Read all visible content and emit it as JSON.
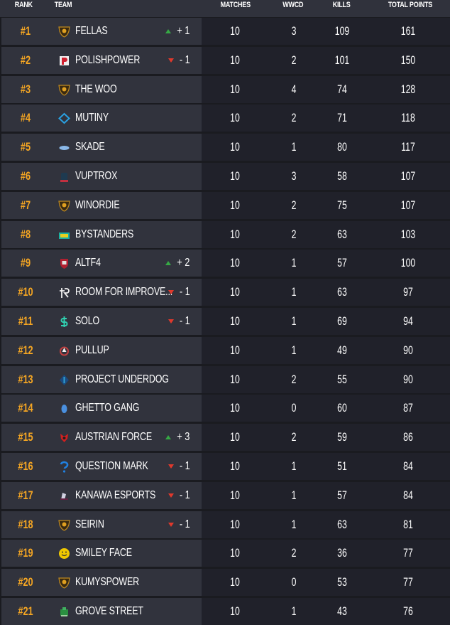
{
  "colors": {
    "rank": "#f5a623",
    "up": "#36a845",
    "down": "#e0392c"
  },
  "header": {
    "rank": "RANK",
    "team": "TEAM",
    "matches": "MATCHES",
    "wwcd": "WWCD",
    "kills": "KILLS",
    "total_points": "TOTAL POINTS"
  },
  "rows": [
    {
      "rank": "#1",
      "team": "FELLAS",
      "logo": "shield-lion-logo",
      "change_dir": "up",
      "change": "+ 1",
      "matches": "10",
      "wwcd": "3",
      "kills": "109",
      "total": "161"
    },
    {
      "rank": "#2",
      "team": "POLISHPOWER",
      "logo": "p-logo",
      "change_dir": "down",
      "change": "- 1",
      "matches": "10",
      "wwcd": "2",
      "kills": "101",
      "total": "150"
    },
    {
      "rank": "#3",
      "team": "THE WOO",
      "logo": "shield-lion-logo",
      "change_dir": "",
      "change": "",
      "matches": "10",
      "wwcd": "4",
      "kills": "74",
      "total": "128"
    },
    {
      "rank": "#4",
      "team": "MUTINY",
      "logo": "diamond-logo",
      "change_dir": "",
      "change": "",
      "matches": "10",
      "wwcd": "2",
      "kills": "71",
      "total": "118"
    },
    {
      "rank": "#5",
      "team": "SKADE",
      "logo": "fish-logo",
      "change_dir": "",
      "change": "",
      "matches": "10",
      "wwcd": "1",
      "kills": "80",
      "total": "117"
    },
    {
      "rank": "#6",
      "team": "VUPTROX",
      "logo": "creature-logo",
      "change_dir": "",
      "change": "",
      "matches": "10",
      "wwcd": "3",
      "kills": "58",
      "total": "107"
    },
    {
      "rank": "#7",
      "team": "WINORDIE",
      "logo": "shield-lion-logo",
      "change_dir": "",
      "change": "",
      "matches": "10",
      "wwcd": "2",
      "kills": "75",
      "total": "107"
    },
    {
      "rank": "#8",
      "team": "BYSTANDERS",
      "logo": "tv-logo",
      "change_dir": "",
      "change": "",
      "matches": "10",
      "wwcd": "2",
      "kills": "63",
      "total": "103"
    },
    {
      "rank": "#9",
      "team": "ALTF4",
      "logo": "shield-f4-logo",
      "change_dir": "up",
      "change": "+ 2",
      "matches": "10",
      "wwcd": "1",
      "kills": "57",
      "total": "100"
    },
    {
      "rank": "#10",
      "team": "ROOM FOR IMPROVE...",
      "logo": "rfi-logo",
      "change_dir": "down",
      "change": "- 1",
      "matches": "10",
      "wwcd": "1",
      "kills": "63",
      "total": "97"
    },
    {
      "rank": "#11",
      "team": "SOLO",
      "logo": "dollar-logo",
      "change_dir": "down",
      "change": "- 1",
      "matches": "10",
      "wwcd": "1",
      "kills": "69",
      "total": "94"
    },
    {
      "rank": "#12",
      "team": "PULLUP",
      "logo": "ring-logo",
      "change_dir": "",
      "change": "",
      "matches": "10",
      "wwcd": "1",
      "kills": "49",
      "total": "90"
    },
    {
      "rank": "#13",
      "team": "PROJECT UNDERDOG",
      "logo": "crystal-logo",
      "change_dir": "",
      "change": "",
      "matches": "10",
      "wwcd": "2",
      "kills": "55",
      "total": "90"
    },
    {
      "rank": "#14",
      "team": "GHETTO GANG",
      "logo": "drop-logo",
      "change_dir": "",
      "change": "",
      "matches": "10",
      "wwcd": "0",
      "kills": "60",
      "total": "87"
    },
    {
      "rank": "#15",
      "team": "AUSTRIAN FORCE",
      "logo": "bull-logo",
      "change_dir": "up",
      "change": "+ 3",
      "matches": "10",
      "wwcd": "2",
      "kills": "59",
      "total": "86"
    },
    {
      "rank": "#16",
      "team": "QUESTION MARK",
      "logo": "question-logo",
      "change_dir": "down",
      "change": "- 1",
      "matches": "10",
      "wwcd": "1",
      "kills": "51",
      "total": "84"
    },
    {
      "rank": "#17",
      "team": "KANAWA ESPORTS",
      "logo": "ninja-logo",
      "change_dir": "down",
      "change": "- 1",
      "matches": "10",
      "wwcd": "1",
      "kills": "57",
      "total": "84"
    },
    {
      "rank": "#18",
      "team": "SEIRIN",
      "logo": "shield-lion-logo",
      "change_dir": "down",
      "change": "- 1",
      "matches": "10",
      "wwcd": "1",
      "kills": "63",
      "total": "81"
    },
    {
      "rank": "#19",
      "team": "SMILEY FACE",
      "logo": "smiley-logo",
      "change_dir": "",
      "change": "",
      "matches": "10",
      "wwcd": "2",
      "kills": "36",
      "total": "77"
    },
    {
      "rank": "#20",
      "team": "KUMYSPOWER",
      "logo": "shield-lion-logo",
      "change_dir": "",
      "change": "",
      "matches": "10",
      "wwcd": "0",
      "kills": "53",
      "total": "77"
    },
    {
      "rank": "#21",
      "team": "GROVE STREET",
      "logo": "green-badge-logo",
      "change_dir": "",
      "change": "",
      "matches": "10",
      "wwcd": "1",
      "kills": "43",
      "total": "76"
    }
  ]
}
